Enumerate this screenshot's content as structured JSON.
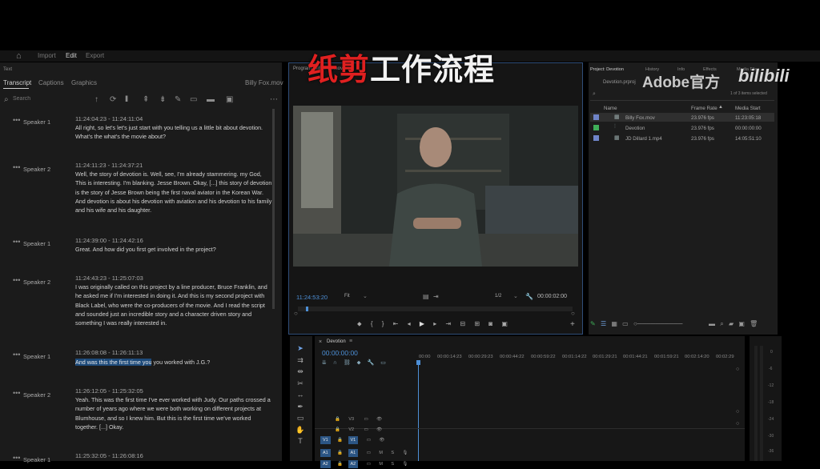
{
  "overlay": {
    "title_red": "纸剪",
    "title_white": "工作流程"
  },
  "watermark": {
    "brand": "Adobe官方",
    "site": "bilibili"
  },
  "topbar": {
    "import": "Import",
    "edit": "Edit",
    "export": "Export"
  },
  "transcript": {
    "panel_label": "Text",
    "tabs": [
      "Transcript",
      "Captions",
      "Graphics"
    ],
    "clip_name": "Billy Fox.mov",
    "search_placeholder": "Search",
    "segments": [
      {
        "speaker": "Speaker 1",
        "time": "11:24:04:23 - 11:24:11:04",
        "text": "All right, so let's let's just start with you telling us a little bit about devotion. What's the what's the movie about?"
      },
      {
        "speaker": "Speaker 2",
        "time": "11:24:11:23 - 11:24:37:21",
        "text": "Well, the story of devotion is. Well, see, I'm already stammering. my God, This is interesting. I'm blanking. Jesse Brown. Okay, [...] this story of devotion is the story of Jesse Brown being the first naval aviator in the Korean War. And devotion is about his devotion with aviation and his devotion to his family and his wife and his daughter."
      },
      {
        "speaker": "Speaker 1",
        "time": "11:24:39:00 - 11:24:42:16",
        "text": "Great. And how did you first get involved in the project?"
      },
      {
        "speaker": "Speaker 2",
        "time": "11:24:43:23 - 11:25:07:03",
        "text": "I was originally called on this project by a line producer, Bruce Franklin, and he asked me if I'm interested in doing it. And this is my second project with Black Label, who were the co-producers of the movie. And I read the script and sounded just an incredible story and a character driven story and something I was really interested in."
      },
      {
        "speaker": "Speaker 1",
        "time": "11:26:08:08 - 11:26:11:13",
        "text_highlight": "And was this the first time you",
        "text_rest": " you worked with J.G.?"
      },
      {
        "speaker": "Speaker 2",
        "time": "11:26:12:05 - 11:25:32:05",
        "text": "Yeah. This was the first time I've ever worked with Judy. Our paths crossed a number of years ago where we were both working on different projects at Blumhouse, and so I knew him. But this is the first time we've worked together. [...] Okay."
      },
      {
        "speaker": "Speaker 1",
        "time": "11:25:32:05 - 11:26:08:16",
        "text": ""
      }
    ]
  },
  "program": {
    "tab_label": "Program: Billy Fox.mov",
    "timecode": "11:24:53:20",
    "fit": "Fit",
    "resolution": "1/2",
    "duration": "00:00:02:00"
  },
  "project": {
    "tabs": [
      "Project: Devotion",
      "History",
      "Info",
      "Effects",
      "Media Files"
    ],
    "file": "Devotion.prproj",
    "selection": "1 of 3 items selected",
    "columns": [
      "Name",
      "Frame Rate",
      "Media Start"
    ],
    "items": [
      {
        "name": "Billy Fox.mov",
        "rate": "23.976 fps",
        "start": "11:23:05:18",
        "color": "#6f84c8"
      },
      {
        "name": "Devotion",
        "rate": "23.976 fps",
        "start": "00:00:00:00",
        "color": "#3fae58"
      },
      {
        "name": "JD Dillard 1.mp4",
        "rate": "23.976 fps",
        "start": "14:05:51:10",
        "color": "#6f84c8"
      }
    ]
  },
  "timeline": {
    "sequence": "Devotion",
    "timecode": "00:00:00:00",
    "ruler": [
      "00:00",
      "00:00:14:23",
      "00:00:29:23",
      "00:00:44:22",
      "00:00:59:22",
      "00:01:14:22",
      "00:01:29:21",
      "00:01:44:21",
      "00:01:59:21",
      "00:02:14:20",
      "00:02:29"
    ],
    "tracks": [
      "V3",
      "V2",
      "V1",
      "A1",
      "A2"
    ],
    "meter_scale": [
      "0",
      "-6",
      "-12",
      "-18",
      "-24",
      "-30",
      "-36"
    ]
  },
  "colors": {
    "accent": "#2f4d78",
    "highlight": "#1d4a7a",
    "title_red": "#e02020"
  }
}
